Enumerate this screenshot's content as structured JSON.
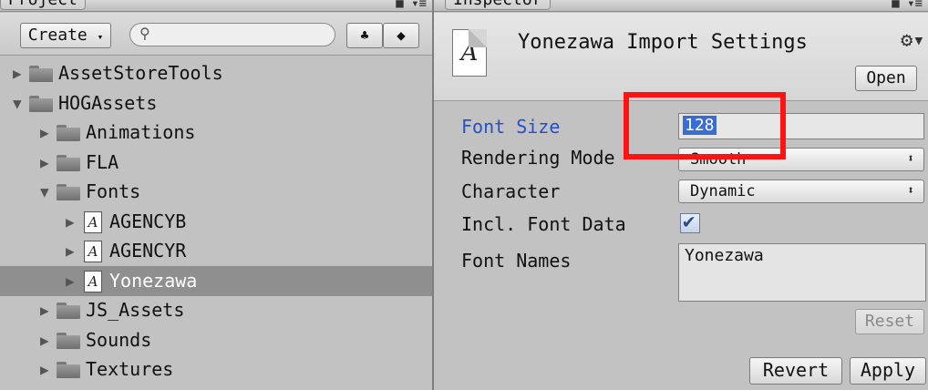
{
  "project": {
    "tab_label": "Project",
    "create_label": "Create",
    "search_placeholder": "",
    "tree": [
      {
        "label": "AssetStoreTools",
        "type": "folder",
        "expanded": false,
        "depth": 0
      },
      {
        "label": "HOGAssets",
        "type": "folder",
        "expanded": true,
        "depth": 0
      },
      {
        "label": "Animations",
        "type": "folder",
        "expanded": false,
        "depth": 1
      },
      {
        "label": "FLA",
        "type": "folder",
        "expanded": false,
        "depth": 1
      },
      {
        "label": "Fonts",
        "type": "folder",
        "expanded": true,
        "depth": 1
      },
      {
        "label": "AGENCYB",
        "type": "font",
        "expanded": false,
        "depth": 2
      },
      {
        "label": "AGENCYR",
        "type": "font",
        "expanded": false,
        "depth": 2
      },
      {
        "label": "Yonezawa",
        "type": "font",
        "expanded": false,
        "depth": 2,
        "selected": true
      },
      {
        "label": "JS_Assets",
        "type": "folder",
        "expanded": false,
        "depth": 1
      },
      {
        "label": "Sounds",
        "type": "folder",
        "expanded": false,
        "depth": 1
      },
      {
        "label": "Textures",
        "type": "folder",
        "expanded": false,
        "depth": 1
      }
    ]
  },
  "inspector": {
    "tab_label": "Inspector",
    "title": "Yonezawa Import Settings",
    "open_label": "Open",
    "props": {
      "font_size_label": "Font Size",
      "font_size_value": "128",
      "rendering_mode_label": "Rendering Mode",
      "rendering_mode_value": "Smooth",
      "character_label": "Character",
      "character_value": "Dynamic",
      "incl_font_data_label": "Incl. Font Data",
      "incl_font_data_checked": true,
      "font_names_label": "Font Names",
      "font_names_value": "Yonezawa"
    },
    "reset_label": "Reset",
    "revert_label": "Revert",
    "apply_label": "Apply"
  },
  "colors": {
    "panel_bg": "#c2c2c2",
    "selection_bg": "#8f8f8f",
    "focus_label": "#2550c9",
    "highlight_box": "#ff1313",
    "selected_text": "#3a6cd6"
  }
}
